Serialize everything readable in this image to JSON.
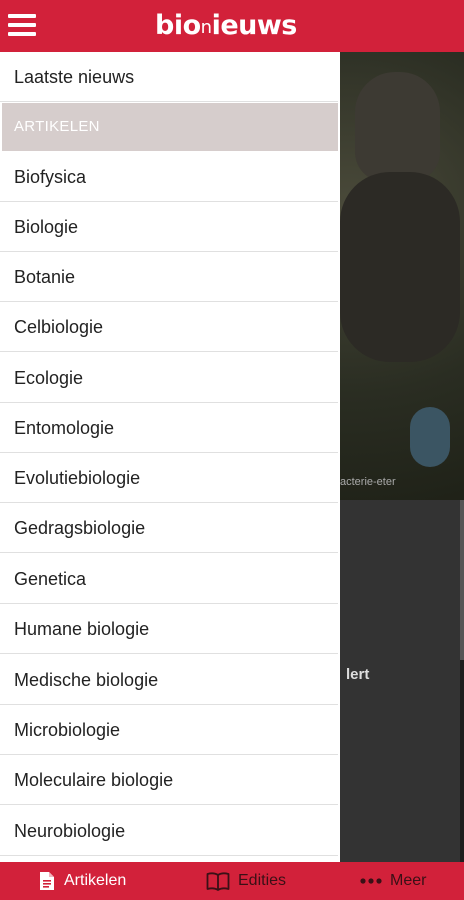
{
  "app": {
    "logo_part1": "bio",
    "logo_part2": "n",
    "logo_part3": "ieuws",
    "accent_color": "#d2213a"
  },
  "background": {
    "caption": "acterie-eter",
    "headline_fragment": "lert"
  },
  "drawer": {
    "top_item": "Laatste nieuws",
    "section_header": "ARTIKELEN",
    "items": [
      "Biofysica",
      "Biologie",
      "Botanie",
      "Celbiologie",
      "Ecologie",
      "Entomologie",
      "Evolutiebiologie",
      "Gedragsbiologie",
      "Genetica",
      "Humane biologie",
      "Medische biologie",
      "Microbiologie",
      "Moleculaire biologie",
      "Neurobiologie"
    ]
  },
  "bottom_nav": {
    "tabs": [
      {
        "label": "Artikelen",
        "icon": "document-icon",
        "selected": true
      },
      {
        "label": "Edities",
        "icon": "book-icon",
        "selected": false
      },
      {
        "label": "Meer",
        "icon": "more-dots-icon",
        "selected": false
      }
    ]
  }
}
